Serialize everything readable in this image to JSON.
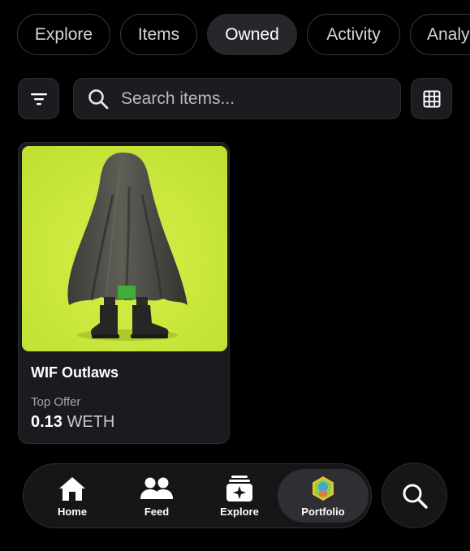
{
  "tabs": [
    {
      "label": "Explore",
      "active": false
    },
    {
      "label": "Items",
      "active": false
    },
    {
      "label": "Owned",
      "active": true
    },
    {
      "label": "Activity",
      "active": false
    },
    {
      "label": "Analy",
      "active": false
    }
  ],
  "toolbar": {
    "filter_icon": "filter-icon",
    "search_placeholder": "Search items...",
    "search_icon": "search-icon",
    "grid_icon": "grid-view-icon"
  },
  "items": [
    {
      "name": "WIF Outlaws",
      "image": "ghost-figure-in-boots-on-lime-background",
      "offer_label": "Top Offer",
      "offer_amount": "0.13",
      "offer_currency": "WETH"
    }
  ],
  "bottom_nav": {
    "items": [
      {
        "label": "Home",
        "icon": "home-icon",
        "active": false
      },
      {
        "label": "Feed",
        "icon": "people-icon",
        "active": false
      },
      {
        "label": "Explore",
        "icon": "sparkle-cards-icon",
        "active": false
      },
      {
        "label": "Portfolio",
        "icon": "avatar-icon",
        "active": true
      }
    ],
    "search_icon": "search-icon"
  },
  "colors": {
    "background": "#000000",
    "surface": "#1c1c20",
    "active_tab": "#27272b",
    "image_bg": "#c8e63c"
  }
}
